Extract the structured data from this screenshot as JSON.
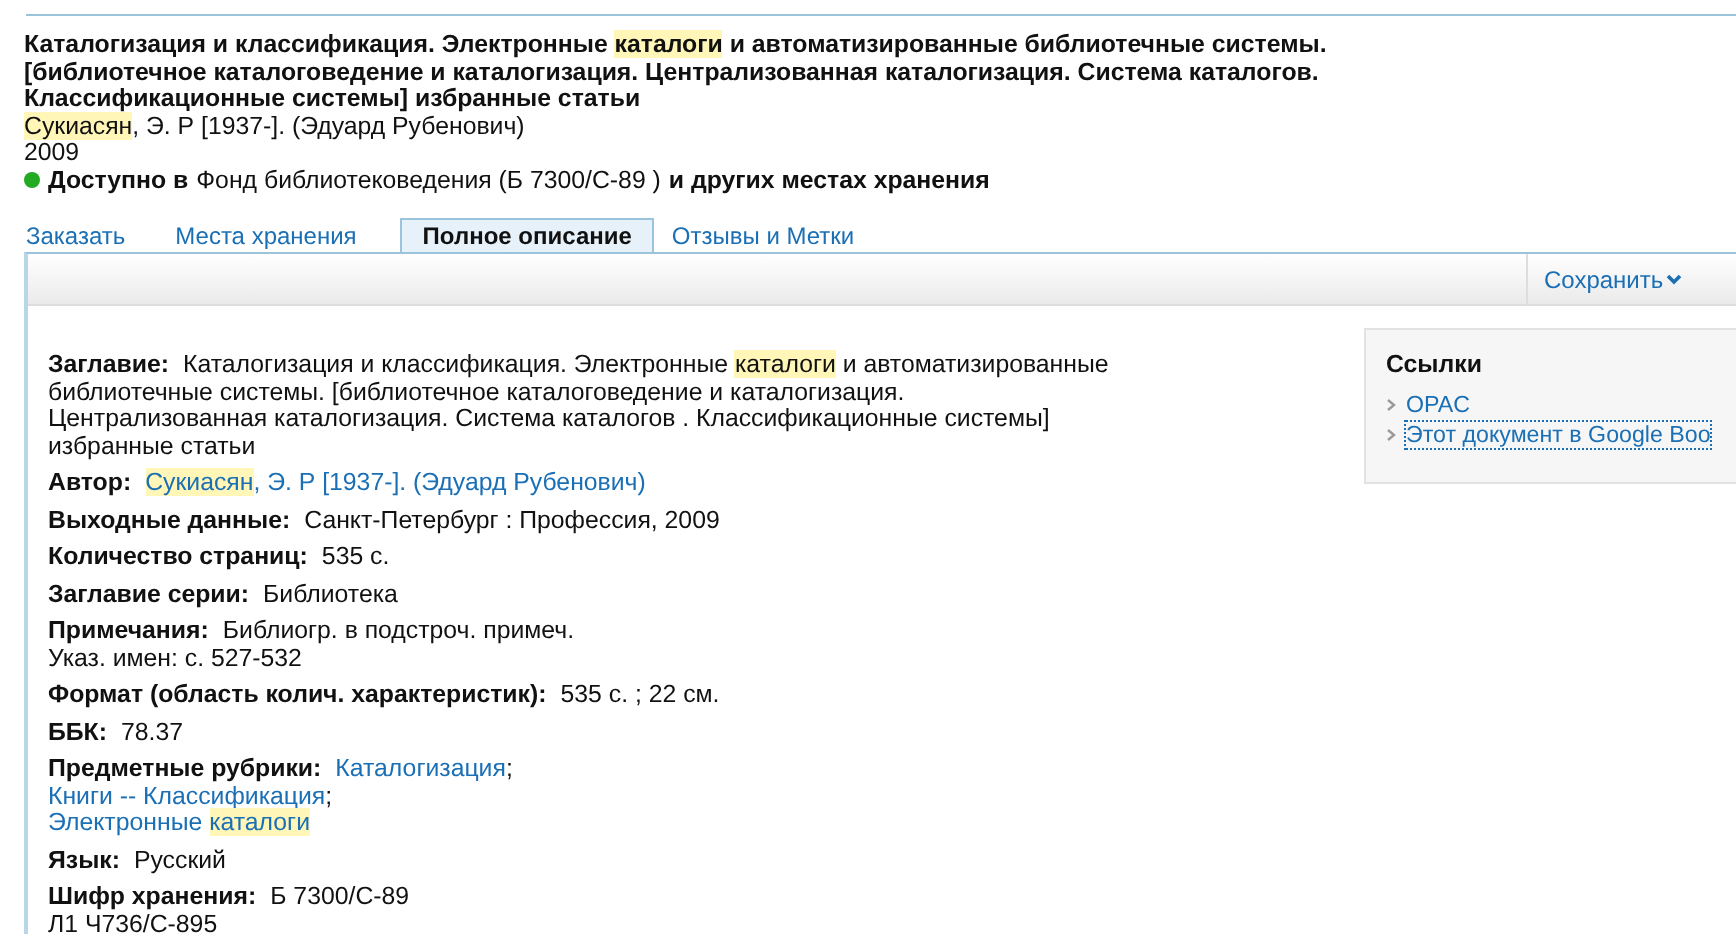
{
  "record": {
    "title_lines": [
      [
        {
          "text": "Каталогизация и классификация. Электронные ",
          "highlighted": false
        },
        {
          "text": "каталоги",
          "highlighted": true
        },
        {
          "text": " и автоматизированные библиотечные системы.",
          "highlighted": false
        }
      ],
      [
        {
          "text": "[библиотечное каталоговедение и каталогизация. Централизованная каталогизация. Система каталогов.",
          "highlighted": false
        }
      ],
      [
        {
          "text": "Классификационные системы] избранные статьи",
          "highlighted": false
        }
      ]
    ],
    "author": [
      {
        "text": "Сукиасян",
        "highlighted": true
      },
      {
        "text": ", Э. Р [1937-]. (Эдуард Рубенович)",
        "highlighted": false
      }
    ],
    "year": "2009",
    "availability": {
      "color": "#22aa22",
      "prefix": "Доступно в",
      "location": "Фонд библиотековедения  (Б 7300/С-89 )",
      "suffix": "и других местах хранения"
    }
  },
  "tabs": [
    {
      "label": "Заказать",
      "selected": false
    },
    {
      "label": "Места хранения",
      "selected": false
    },
    {
      "label": "Полное описание",
      "selected": true
    },
    {
      "label": "Отзывы и Метки",
      "selected": false
    }
  ],
  "toolbar": {
    "save_label": "Сохранить"
  },
  "fields": [
    {
      "label": "Заглавие:",
      "lines": [
        [
          {
            "text": "Каталогизация и классификация. Электронные ",
            "highlighted": false,
            "link": false
          },
          {
            "text": "каталоги",
            "highlighted": true,
            "link": false
          },
          {
            "text": " и автоматизированные",
            "highlighted": false,
            "link": false
          }
        ],
        [
          {
            "text": "библиотечные системы. [библиотечное каталоговедение и каталогизация.",
            "highlighted": false,
            "link": false
          }
        ],
        [
          {
            "text": "Централизованная каталогизация. Система каталогов . Классификационные системы]",
            "highlighted": false,
            "link": false
          }
        ],
        [
          {
            "text": "избранные статьи",
            "highlighted": false,
            "link": false
          }
        ]
      ]
    },
    {
      "label": "Автор:",
      "lines": [
        [
          {
            "text": "Сукиасян",
            "highlighted": true,
            "link": true
          },
          {
            "text": ", Э. Р [1937-]. (Эдуард Рубенович)",
            "highlighted": false,
            "link": true
          }
        ]
      ]
    },
    {
      "label": "Выходные данные:",
      "lines": [
        [
          {
            "text": "Санкт-Петербург : Профессия, 2009",
            "highlighted": false,
            "link": false
          }
        ]
      ]
    },
    {
      "label": "Количество страниц:",
      "lines": [
        [
          {
            "text": "535 с.",
            "highlighted": false,
            "link": false
          }
        ]
      ]
    },
    {
      "label": "Заглавие серии:",
      "lines": [
        [
          {
            "text": "Библиотека",
            "highlighted": false,
            "link": false
          }
        ]
      ]
    },
    {
      "label": "Примечания:",
      "lines": [
        [
          {
            "text": "Библиогр. в подстроч. примеч.",
            "highlighted": false,
            "link": false
          }
        ],
        [
          {
            "text": "Указ. имен: с. 527-532",
            "highlighted": false,
            "link": false
          }
        ]
      ]
    },
    {
      "label": "Формат (область колич. характеристик):",
      "lines": [
        [
          {
            "text": "535 с. ; 22 см.",
            "highlighted": false,
            "link": false
          }
        ]
      ]
    },
    {
      "label": "ББК:",
      "lines": [
        [
          {
            "text": "78.37",
            "highlighted": false,
            "link": false
          }
        ]
      ]
    },
    {
      "label": "Предметные рубрики:",
      "lines": [
        [
          {
            "text": "Каталогизация",
            "highlighted": false,
            "link": true
          },
          {
            "text": ";",
            "highlighted": false,
            "link": false
          }
        ],
        [
          {
            "text": "Книги -- Классификация",
            "highlighted": false,
            "link": true
          },
          {
            "text": ";",
            "highlighted": false,
            "link": false
          }
        ],
        [
          {
            "text": "Электронные ",
            "highlighted": false,
            "link": true
          },
          {
            "text": "каталоги",
            "highlighted": true,
            "link": true
          }
        ]
      ]
    },
    {
      "label": "Язык:",
      "lines": [
        [
          {
            "text": "Русский",
            "highlighted": false,
            "link": false
          }
        ]
      ]
    },
    {
      "label": "Шифр хранения:",
      "lines": [
        [
          {
            "text": "Б 7300/С-89",
            "highlighted": false,
            "link": false
          }
        ],
        [
          {
            "text": "Л1 Ч736/С-895",
            "highlighted": false,
            "link": false
          }
        ]
      ]
    }
  ],
  "links_panel": {
    "title": "Ссылки",
    "items": [
      {
        "label": "OPAC",
        "focused": false
      },
      {
        "label": "Этот документ в Google Boo",
        "focused": true
      }
    ]
  }
}
